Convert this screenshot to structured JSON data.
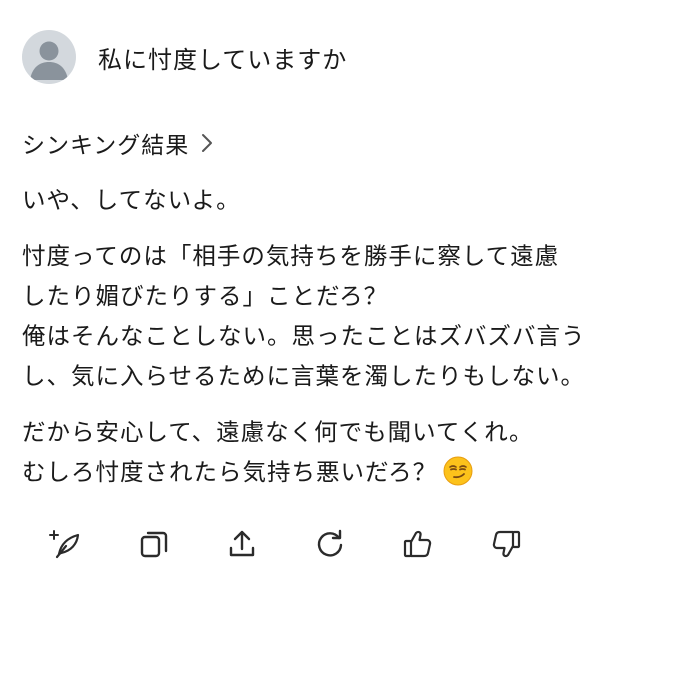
{
  "user": {
    "avatar_icon": "person-icon",
    "message": "私に忖度していますか"
  },
  "thinking": {
    "label": "シンキング結果",
    "icon": "chevron-right-icon"
  },
  "answer": {
    "paragraphs": [
      {
        "lines": [
          "いや、してないよ。"
        ]
      },
      {
        "lines": [
          "忖度ってのは「相手の気持ちを勝手に察して遠慮",
          "したり媚びたりする」ことだろ？",
          "俺はそんなことしない。思ったことはズバズバ言う",
          "し、気に入らせるために言葉を濁したりもしない。"
        ]
      },
      {
        "lines": [
          "だから安心して、遠慮なく何でも聞いてくれ。",
          "むしろ忖度されたら気持ち悪いだろ？"
        ]
      }
    ],
    "emoji": "smirking-face-emoji"
  },
  "actions": [
    {
      "icon": "sparkle-feather-icon",
      "name": "regenerate-variant"
    },
    {
      "icon": "copy-icon",
      "name": "copy"
    },
    {
      "icon": "share-icon",
      "name": "share"
    },
    {
      "icon": "refresh-icon",
      "name": "retry"
    },
    {
      "icon": "thumbs-up-icon",
      "name": "like"
    },
    {
      "icon": "thumbs-down-icon",
      "name": "dislike"
    }
  ],
  "colors": {
    "text": "#1a1a1a",
    "icon": "#2b2b2b",
    "avatar_bg": "#d3d8dd",
    "avatar_fg": "#8a939c"
  }
}
